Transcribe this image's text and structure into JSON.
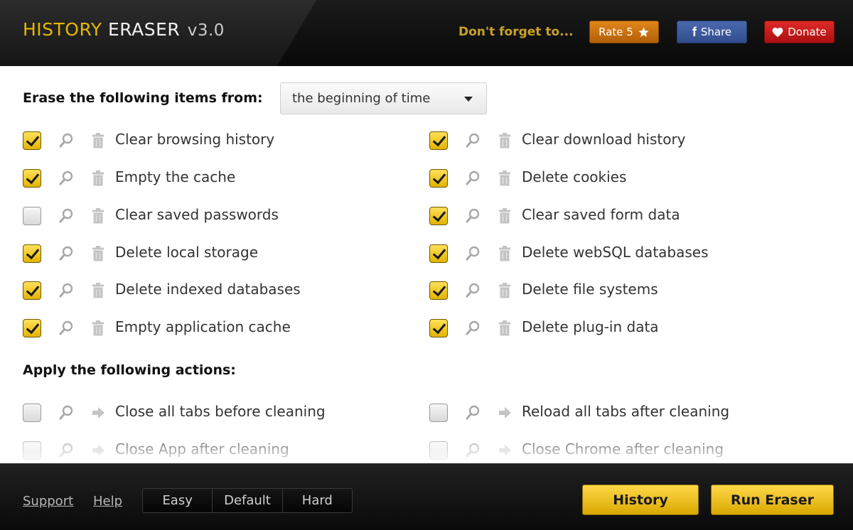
{
  "header": {
    "title_part1": "HISTORY",
    "title_part2": "ERASER",
    "version": "v3.0",
    "reminder": "Don't forget to...",
    "rate_label": "Rate 5",
    "share_icon": "f",
    "share_label": "Share",
    "donate_label": "Donate"
  },
  "erase": {
    "label": "Erase the following items from:",
    "range_value": "the beginning of time",
    "left": [
      {
        "label": "Clear browsing history",
        "checked": true
      },
      {
        "label": "Empty the cache",
        "checked": true
      },
      {
        "label": "Clear saved passwords",
        "checked": false
      },
      {
        "label": "Delete local storage",
        "checked": true
      },
      {
        "label": "Delete indexed databases",
        "checked": true
      },
      {
        "label": "Empty application cache",
        "checked": true
      }
    ],
    "right": [
      {
        "label": "Clear download history",
        "checked": true
      },
      {
        "label": "Delete cookies",
        "checked": true
      },
      {
        "label": "Clear saved form data",
        "checked": true
      },
      {
        "label": "Delete webSQL databases",
        "checked": true
      },
      {
        "label": "Delete file systems",
        "checked": true
      },
      {
        "label": "Delete plug-in data",
        "checked": true
      }
    ]
  },
  "actions": {
    "label": "Apply the following actions:",
    "left": [
      {
        "label": "Close all tabs before cleaning",
        "checked": false
      },
      {
        "label": "Close App after cleaning",
        "checked": false
      }
    ],
    "right": [
      {
        "label": "Reload all tabs after cleaning",
        "checked": false
      },
      {
        "label": "Close Chrome after cleaning",
        "checked": false
      }
    ]
  },
  "footer": {
    "support_label": "Support",
    "help_label": "Help",
    "modes": [
      "Easy",
      "Default",
      "Hard"
    ],
    "history_button": "History",
    "run_button": "Run Eraser"
  },
  "colors": {
    "accent_yellow": "#e6b800",
    "rate_orange": "#c96f10",
    "share_blue": "#3b5998",
    "donate_red": "#cc1a1a"
  },
  "icons": {
    "row_search": "magnifier-icon",
    "erase_row": "trash-icon",
    "action_row": "arrow-right-icon",
    "rate": "star-icon",
    "donate": "heart-icon",
    "dropdown": "caret-down-icon"
  }
}
